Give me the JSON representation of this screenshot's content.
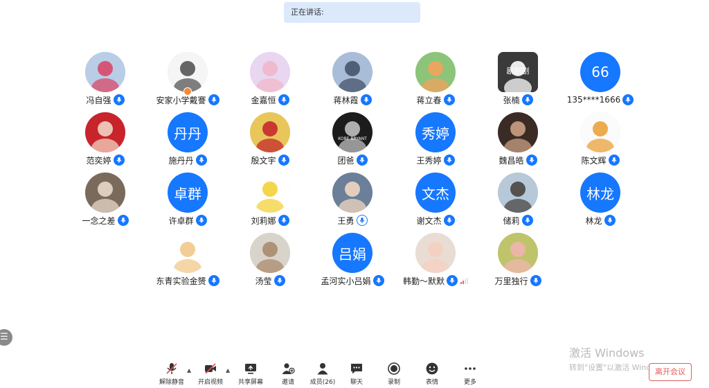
{
  "speaking": {
    "label": "正在讲话:"
  },
  "participants": [
    {
      "name": "冯自强",
      "avatar_type": "photo",
      "palette": [
        "#b9cde6",
        "#d9486a"
      ],
      "mic": "blue"
    },
    {
      "name": "安家小学戴謇",
      "avatar_type": "photo",
      "palette": [
        "#f5f5f5",
        "#555555"
      ],
      "mic": "blue",
      "host": true
    },
    {
      "name": "金嘉恒",
      "avatar_type": "photo",
      "palette": [
        "#e9d6f0",
        "#f0b7c9"
      ],
      "mic": "blue"
    },
    {
      "name": "蒋林霞",
      "avatar_type": "photo",
      "palette": [
        "#a9bdd8",
        "#44546b"
      ],
      "mic": "blue"
    },
    {
      "name": "蒋立春",
      "avatar_type": "photo",
      "palette": [
        "#8cc47a",
        "#f2a35e"
      ],
      "mic": "blue"
    },
    {
      "name": "张楠",
      "avatar_type": "photo",
      "palette": [
        "#3a3a3a",
        "#ffffff"
      ],
      "mic": "blue",
      "square": true,
      "caption": "剧剧剧"
    },
    {
      "name": "135****1666",
      "avatar_type": "text",
      "text": "66",
      "mic": "blue"
    },
    {
      "name": "范奕婷",
      "avatar_type": "photo",
      "palette": [
        "#c8242b",
        "#f1d3c2"
      ],
      "mic": "blue"
    },
    {
      "name": "施丹丹",
      "avatar_type": "text",
      "text": "丹丹",
      "mic": "blue"
    },
    {
      "name": "殷文宇",
      "avatar_type": "photo",
      "palette": [
        "#e8c65a",
        "#c7282e"
      ],
      "mic": "blue"
    },
    {
      "name": "团爸",
      "avatar_type": "photo",
      "palette": [
        "#1c1c1c",
        "#bfbfbf"
      ],
      "mic": "blue",
      "caption": "KOBE BRYANT"
    },
    {
      "name": "王秀婷",
      "avatar_type": "text",
      "text": "秀婷",
      "mic": "blue"
    },
    {
      "name": "魏昌皓",
      "avatar_type": "photo",
      "palette": [
        "#3b2b25",
        "#caa083"
      ],
      "mic": "blue"
    },
    {
      "name": "陈文辉",
      "avatar_type": "photo",
      "palette": [
        "#fbfbfb",
        "#e9a23b"
      ],
      "mic": "blue"
    },
    {
      "name": "一念之差",
      "avatar_type": "photo",
      "palette": [
        "#7a6a5c",
        "#e7d8c9"
      ],
      "mic": "blue"
    },
    {
      "name": "许卓群",
      "avatar_type": "text",
      "text": "卓群",
      "mic": "blue"
    },
    {
      "name": "刘莉娜",
      "avatar_type": "photo",
      "palette": [
        "#ffffff",
        "#f3d23a"
      ],
      "mic": "blue"
    },
    {
      "name": "王勇",
      "avatar_type": "photo",
      "palette": [
        "#6b7f98",
        "#f1d7c2"
      ],
      "mic": "plain"
    },
    {
      "name": "谢文杰",
      "avatar_type": "text",
      "text": "文杰",
      "mic": "blue"
    },
    {
      "name": "储莉",
      "avatar_type": "photo",
      "palette": [
        "#b7c9d9",
        "#4a4440"
      ],
      "mic": "blue"
    },
    {
      "name": "林龙",
      "avatar_type": "text",
      "text": "林龙",
      "mic": "blue"
    },
    {
      "name": "东青实验金赟",
      "avatar_type": "photo",
      "palette": [
        "#ffffff",
        "#f1c889"
      ],
      "mic": "blue"
    },
    {
      "name": "汤莹",
      "avatar_type": "photo",
      "palette": [
        "#d9d4cb",
        "#a98b6c"
      ],
      "mic": "blue"
    },
    {
      "name": "孟河实小吕娟",
      "avatar_type": "text",
      "text": "吕娟",
      "mic": "blue"
    },
    {
      "name": "韩勤～默默",
      "avatar_type": "photo",
      "palette": [
        "#e9ddd3",
        "#f4cfc0"
      ],
      "mic": "blue",
      "signal": true
    },
    {
      "name": "万里独行",
      "avatar_type": "photo",
      "palette": [
        "#bfc46a",
        "#f0b5b0"
      ],
      "mic": "blue"
    }
  ],
  "side_handle": {
    "icon": "menu-icon",
    "glyph": "☰"
  },
  "watermark": {
    "line1": "激活 Windows",
    "line2": "转到\"设置\"以激活 Windows。"
  },
  "toolbar": {
    "items": [
      {
        "key": "mute",
        "label": "解除静音",
        "icon": "mic-muted-icon",
        "caret": true
      },
      {
        "key": "video",
        "label": "开启视频",
        "icon": "camera-off-icon",
        "caret": true
      },
      {
        "key": "share",
        "label": "共享屏幕",
        "icon": "share-screen-icon"
      },
      {
        "key": "invite",
        "label": "邀请",
        "icon": "invite-icon"
      },
      {
        "key": "members",
        "label": "成员(26)",
        "icon": "members-icon"
      },
      {
        "key": "chat",
        "label": "聊天",
        "icon": "chat-icon"
      },
      {
        "key": "record",
        "label": "录制",
        "icon": "record-icon"
      },
      {
        "key": "emoji",
        "label": "表情",
        "icon": "emoji-icon"
      },
      {
        "key": "more",
        "label": "更多",
        "icon": "more-icon"
      }
    ],
    "leave_label": "离开会议"
  },
  "colors": {
    "accent": "#1677ff",
    "danger": "#e45b5b"
  }
}
